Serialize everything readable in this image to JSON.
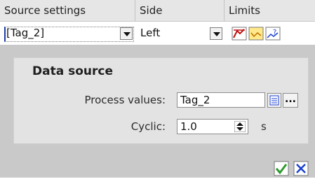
{
  "columns": [
    "Source settings",
    "Side",
    "Limits"
  ],
  "row": {
    "source": "[Tag_2]",
    "side": "Left"
  },
  "panel": {
    "title": "Data source",
    "process_label": "Process values:",
    "process_value": "Tag_2",
    "more_label": "...",
    "cyclic_label": "Cyclic:",
    "cyclic_value": "1.0",
    "cyclic_unit": "s"
  },
  "colors": {
    "accent_green": "#2f9a2f",
    "accent_blue": "#1a3fd0"
  }
}
